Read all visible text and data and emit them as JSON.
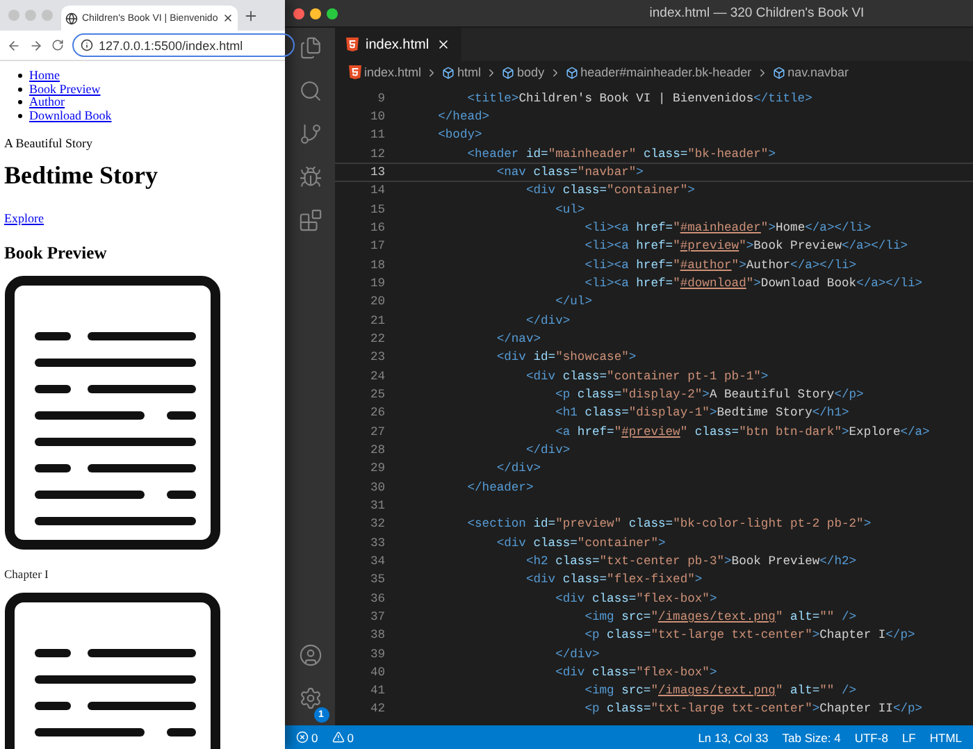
{
  "browser": {
    "tab": {
      "title": "Children's Book VI | Bienvenido"
    },
    "address": "127.0.0.1:5500/index.html",
    "page": {
      "nav_links": [
        "Home",
        "Book Preview",
        "Author",
        "Download Book"
      ],
      "tagline": "A Beautiful Story",
      "heading": "Bedtime Story",
      "link": "Explore",
      "section_heading": "Book Preview",
      "chapters": [
        "Chapter I"
      ]
    }
  },
  "editor": {
    "window_title": "index.html — 320 Children's Book VI",
    "tab": {
      "label": "index.html",
      "selected": true
    },
    "breadcrumbs": [
      "index.html",
      "html",
      "body",
      "header#mainheader.bk-header",
      "nav.navbar"
    ],
    "lines": [
      {
        "number": "9",
        "current": false,
        "tokens": [
          {
            "kind": "tag",
            "text": "        <title>"
          },
          {
            "kind": "text",
            "text": "Children's Book VI | Bienvenidos"
          },
          {
            "kind": "tag",
            "text": "</title>"
          }
        ]
      },
      {
        "number": "10",
        "current": false,
        "tokens": [
          {
            "kind": "tag",
            "text": "    </head>"
          }
        ]
      },
      {
        "number": "11",
        "current": false,
        "tokens": [
          {
            "kind": "tag",
            "text": "    <body>"
          }
        ]
      },
      {
        "number": "12",
        "current": false,
        "tokens": [
          {
            "kind": "tag",
            "text": "        <header"
          },
          {
            "kind": "attr",
            "text": " id="
          },
          {
            "kind": "str",
            "text": "\"mainheader\""
          },
          {
            "kind": "attr",
            "text": " class="
          },
          {
            "kind": "str",
            "text": "\"bk-header\""
          },
          {
            "kind": "tag",
            "text": ">"
          }
        ]
      },
      {
        "number": "13",
        "current": true,
        "tokens": [
          {
            "kind": "tag",
            "text": "            <nav"
          },
          {
            "kind": "attr",
            "text": " class="
          },
          {
            "kind": "str",
            "text": "\"navbar\""
          },
          {
            "kind": "tag",
            "text": ">"
          }
        ]
      },
      {
        "number": "14",
        "current": false,
        "tokens": [
          {
            "kind": "tag",
            "text": "                <div"
          },
          {
            "kind": "attr",
            "text": " class="
          },
          {
            "kind": "str",
            "text": "\"container\""
          },
          {
            "kind": "tag",
            "text": ">"
          }
        ]
      },
      {
        "number": "15",
        "current": false,
        "tokens": [
          {
            "kind": "tag",
            "text": "                    <ul>"
          }
        ]
      },
      {
        "number": "16",
        "current": false,
        "tokens": [
          {
            "kind": "tag",
            "text": "                        <li><a"
          },
          {
            "kind": "attr",
            "text": " href="
          },
          {
            "kind": "str",
            "text": "\""
          },
          {
            "kind": "link",
            "text": "#mainheader"
          },
          {
            "kind": "str",
            "text": "\""
          },
          {
            "kind": "tag",
            "text": ">"
          },
          {
            "kind": "text",
            "text": "Home"
          },
          {
            "kind": "tag",
            "text": "</a></li>"
          }
        ]
      },
      {
        "number": "17",
        "current": false,
        "tokens": [
          {
            "kind": "tag",
            "text": "                        <li><a"
          },
          {
            "kind": "attr",
            "text": " href="
          },
          {
            "kind": "str",
            "text": "\""
          },
          {
            "kind": "link",
            "text": "#preview"
          },
          {
            "kind": "str",
            "text": "\""
          },
          {
            "kind": "tag",
            "text": ">"
          },
          {
            "kind": "text",
            "text": "Book Preview"
          },
          {
            "kind": "tag",
            "text": "</a></li>"
          }
        ]
      },
      {
        "number": "18",
        "current": false,
        "tokens": [
          {
            "kind": "tag",
            "text": "                        <li><a"
          },
          {
            "kind": "attr",
            "text": " href="
          },
          {
            "kind": "str",
            "text": "\""
          },
          {
            "kind": "link",
            "text": "#author"
          },
          {
            "kind": "str",
            "text": "\""
          },
          {
            "kind": "tag",
            "text": ">"
          },
          {
            "kind": "text",
            "text": "Author"
          },
          {
            "kind": "tag",
            "text": "</a></li>"
          }
        ]
      },
      {
        "number": "19",
        "current": false,
        "tokens": [
          {
            "kind": "tag",
            "text": "                        <li><a"
          },
          {
            "kind": "attr",
            "text": " href="
          },
          {
            "kind": "str",
            "text": "\""
          },
          {
            "kind": "link",
            "text": "#download"
          },
          {
            "kind": "str",
            "text": "\""
          },
          {
            "kind": "tag",
            "text": ">"
          },
          {
            "kind": "text",
            "text": "Download Book"
          },
          {
            "kind": "tag",
            "text": "</a></li>"
          }
        ]
      },
      {
        "number": "20",
        "current": false,
        "tokens": [
          {
            "kind": "tag",
            "text": "                    </ul>"
          }
        ]
      },
      {
        "number": "21",
        "current": false,
        "tokens": [
          {
            "kind": "tag",
            "text": "                </div>"
          }
        ]
      },
      {
        "number": "22",
        "current": false,
        "tokens": [
          {
            "kind": "tag",
            "text": "            </nav>"
          }
        ]
      },
      {
        "number": "23",
        "current": false,
        "tokens": [
          {
            "kind": "tag",
            "text": "            <div"
          },
          {
            "kind": "attr",
            "text": " id="
          },
          {
            "kind": "str",
            "text": "\"showcase\""
          },
          {
            "kind": "tag",
            "text": ">"
          }
        ]
      },
      {
        "number": "24",
        "current": false,
        "tokens": [
          {
            "kind": "tag",
            "text": "                <div"
          },
          {
            "kind": "attr",
            "text": " class="
          },
          {
            "kind": "str",
            "text": "\"container pt-1 pb-1\""
          },
          {
            "kind": "tag",
            "text": ">"
          }
        ]
      },
      {
        "number": "25",
        "current": false,
        "tokens": [
          {
            "kind": "tag",
            "text": "                    <p"
          },
          {
            "kind": "attr",
            "text": " class="
          },
          {
            "kind": "str",
            "text": "\"display-2\""
          },
          {
            "kind": "tag",
            "text": ">"
          },
          {
            "kind": "text",
            "text": "A Beautiful Story"
          },
          {
            "kind": "tag",
            "text": "</p>"
          }
        ]
      },
      {
        "number": "26",
        "current": false,
        "tokens": [
          {
            "kind": "tag",
            "text": "                    <h1"
          },
          {
            "kind": "attr",
            "text": " class="
          },
          {
            "kind": "str",
            "text": "\"display-1\""
          },
          {
            "kind": "tag",
            "text": ">"
          },
          {
            "kind": "text",
            "text": "Bedtime Story"
          },
          {
            "kind": "tag",
            "text": "</h1>"
          }
        ]
      },
      {
        "number": "27",
        "current": false,
        "tokens": [
          {
            "kind": "tag",
            "text": "                    <a"
          },
          {
            "kind": "attr",
            "text": " href="
          },
          {
            "kind": "str",
            "text": "\""
          },
          {
            "kind": "link",
            "text": "#preview"
          },
          {
            "kind": "str",
            "text": "\""
          },
          {
            "kind": "attr",
            "text": " class="
          },
          {
            "kind": "str",
            "text": "\"btn btn-dark\""
          },
          {
            "kind": "tag",
            "text": ">"
          },
          {
            "kind": "text",
            "text": "Explore"
          },
          {
            "kind": "tag",
            "text": "</a>"
          }
        ]
      },
      {
        "number": "28",
        "current": false,
        "tokens": [
          {
            "kind": "tag",
            "text": "                </div>"
          }
        ]
      },
      {
        "number": "29",
        "current": false,
        "tokens": [
          {
            "kind": "tag",
            "text": "            </div>"
          }
        ]
      },
      {
        "number": "30",
        "current": false,
        "tokens": [
          {
            "kind": "tag",
            "text": "        </header>"
          }
        ]
      },
      {
        "number": "31",
        "current": false
      },
      {
        "number": "32",
        "current": false,
        "tokens": [
          {
            "kind": "tag",
            "text": "        <section"
          },
          {
            "kind": "attr",
            "text": " id="
          },
          {
            "kind": "str",
            "text": "\"preview\""
          },
          {
            "kind": "attr",
            "text": " class="
          },
          {
            "kind": "str",
            "text": "\"bk-color-light pt-2 pb-2\""
          },
          {
            "kind": "tag",
            "text": ">"
          }
        ]
      },
      {
        "number": "33",
        "current": false,
        "tokens": [
          {
            "kind": "tag",
            "text": "            <div"
          },
          {
            "kind": "attr",
            "text": " class="
          },
          {
            "kind": "str",
            "text": "\"container\""
          },
          {
            "kind": "tag",
            "text": ">"
          }
        ]
      },
      {
        "number": "34",
        "current": false,
        "tokens": [
          {
            "kind": "tag",
            "text": "                <h2"
          },
          {
            "kind": "attr",
            "text": " class="
          },
          {
            "kind": "str",
            "text": "\"txt-center pb-3\""
          },
          {
            "kind": "tag",
            "text": ">"
          },
          {
            "kind": "text",
            "text": "Book Preview"
          },
          {
            "kind": "tag",
            "text": "</h2>"
          }
        ]
      },
      {
        "number": "35",
        "current": false,
        "tokens": [
          {
            "kind": "tag",
            "text": "                <div"
          },
          {
            "kind": "attr",
            "text": " class="
          },
          {
            "kind": "str",
            "text": "\"flex-fixed\""
          },
          {
            "kind": "tag",
            "text": ">"
          }
        ]
      },
      {
        "number": "36",
        "current": false,
        "tokens": [
          {
            "kind": "tag",
            "text": "                    <div"
          },
          {
            "kind": "attr",
            "text": " class="
          },
          {
            "kind": "str",
            "text": "\"flex-box\""
          },
          {
            "kind": "tag",
            "text": ">"
          }
        ]
      },
      {
        "number": "37",
        "current": false,
        "tokens": [
          {
            "kind": "tag",
            "text": "                        <img"
          },
          {
            "kind": "attr",
            "text": " src="
          },
          {
            "kind": "str",
            "text": "\""
          },
          {
            "kind": "link",
            "text": "/images/text.png"
          },
          {
            "kind": "str",
            "text": "\""
          },
          {
            "kind": "attr",
            "text": " alt="
          },
          {
            "kind": "str",
            "text": "\"\""
          },
          {
            "kind": "tag",
            "text": " />"
          }
        ]
      },
      {
        "number": "38",
        "current": false,
        "tokens": [
          {
            "kind": "tag",
            "text": "                        <p"
          },
          {
            "kind": "attr",
            "text": " class="
          },
          {
            "kind": "str",
            "text": "\"txt-large txt-center\""
          },
          {
            "kind": "tag",
            "text": ">"
          },
          {
            "kind": "text",
            "text": "Chapter I"
          },
          {
            "kind": "tag",
            "text": "</p>"
          }
        ]
      },
      {
        "number": "39",
        "current": false,
        "tokens": [
          {
            "kind": "tag",
            "text": "                    </div>"
          }
        ]
      },
      {
        "number": "40",
        "current": false,
        "tokens": [
          {
            "kind": "tag",
            "text": "                    <div"
          },
          {
            "kind": "attr",
            "text": " class="
          },
          {
            "kind": "str",
            "text": "\"flex-box\""
          },
          {
            "kind": "tag",
            "text": ">"
          }
        ]
      },
      {
        "number": "41",
        "current": false,
        "tokens": [
          {
            "kind": "tag",
            "text": "                        <img"
          },
          {
            "kind": "attr",
            "text": " src="
          },
          {
            "kind": "str",
            "text": "\""
          },
          {
            "kind": "link",
            "text": "/images/text.png"
          },
          {
            "kind": "str",
            "text": "\""
          },
          {
            "kind": "attr",
            "text": " alt="
          },
          {
            "kind": "str",
            "text": "\"\""
          },
          {
            "kind": "tag",
            "text": " />"
          }
        ]
      },
      {
        "number": "42",
        "current": false,
        "tokens": [
          {
            "kind": "tag",
            "text": "                        <p"
          },
          {
            "kind": "attr",
            "text": " class="
          },
          {
            "kind": "str",
            "text": "\"txt-large txt-center\""
          },
          {
            "kind": "tag",
            "text": ">"
          },
          {
            "kind": "text",
            "text": "Chapter II"
          },
          {
            "kind": "tag",
            "text": "</p>"
          }
        ]
      }
    ],
    "settings_badge": "1",
    "status_bar": {
      "errors": "0",
      "warnings": "0",
      "items": [
        "Ln 13, Col 33",
        "Tab Size: 4",
        "UTF-8",
        "LF",
        "HTML"
      ]
    }
  }
}
